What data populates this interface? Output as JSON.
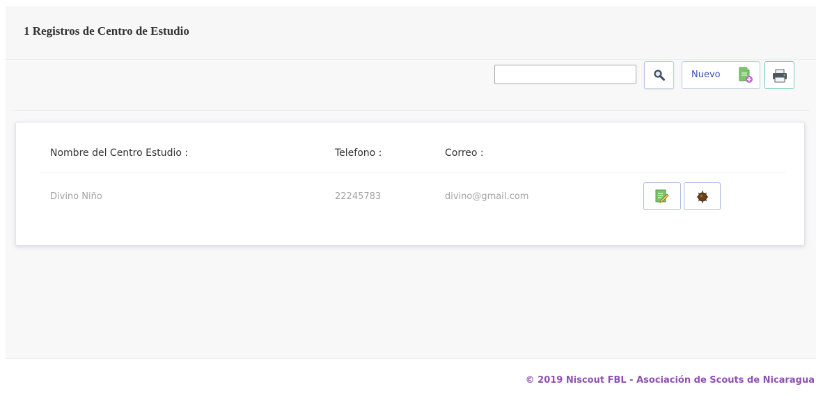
{
  "panel": {
    "title": "1 Registros de Centro de Estudio"
  },
  "toolbar": {
    "search_value": "",
    "new_label": "Nuevo",
    "icons": {
      "search": "magnifier-icon",
      "new": "add-document-icon",
      "print": "printer-icon"
    }
  },
  "table": {
    "headers": [
      "Nombre del Centro Estudio :",
      "Telefono :",
      "Correo :"
    ],
    "rows": [
      {
        "nombre": "Divino Niño",
        "telefono": "22245783",
        "correo": "divino@gmail.com",
        "actions": [
          "edit-icon",
          "delete-icon"
        ]
      }
    ]
  },
  "footer": {
    "text": "© 2019 Niscout FBL - Asociación de Scouts de Nicaragua"
  },
  "colors": {
    "footer_text": "#8e4fb3",
    "new_label": "#3b53b7",
    "button_border": "#b7c7e6",
    "print_border": "#6fc6b4"
  }
}
